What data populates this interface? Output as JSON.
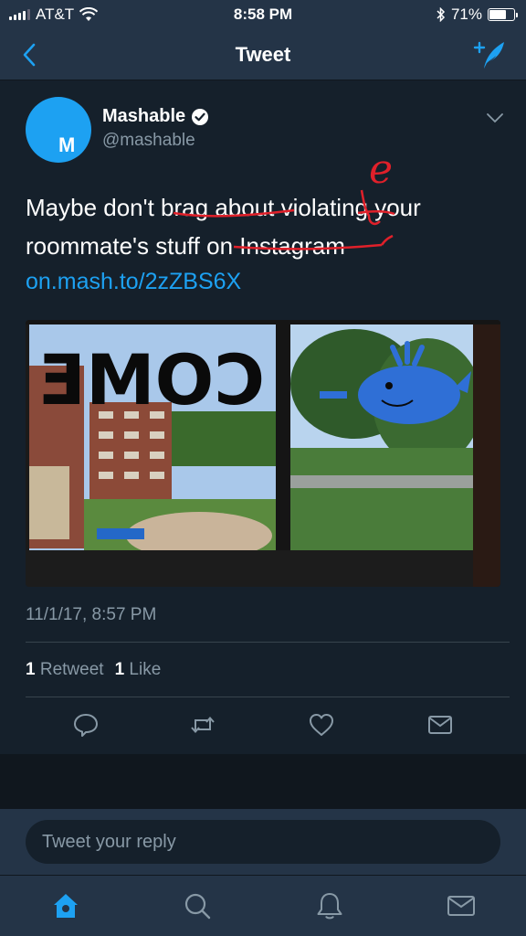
{
  "status_bar": {
    "carrier": "AT&T",
    "time": "8:58 PM",
    "battery": "71%",
    "battery_level": 0.71,
    "icons": [
      "signal-icon",
      "wifi-icon",
      "bluetooth-icon",
      "battery-icon"
    ]
  },
  "nav": {
    "title": "Tweet",
    "back_icon": "chevron-left-icon",
    "compose_icon": "compose-tweet-icon"
  },
  "tweet": {
    "author_name": "Mashable",
    "author_handle": "@mashable",
    "avatar_letter": "M",
    "text_line1": "Maybe don't brag about violating your",
    "text_line2": "roommate's stuff on Instagram",
    "handwritten_annotation": "e",
    "link": "on.mash.to/2zZBS6X",
    "photo_sign_text": "COME",
    "timestamp": "11/1/17, 8:57 PM",
    "retweet_count": "1",
    "retweet_label": "Retweet",
    "like_count": "1",
    "like_label": "Like",
    "actions": [
      "reply-icon",
      "retweet-icon",
      "like-icon",
      "share-icon"
    ]
  },
  "reply": {
    "placeholder": "Tweet your reply"
  },
  "tabbar": {
    "items": [
      "home-icon",
      "search-icon",
      "notifications-icon",
      "messages-icon"
    ],
    "active": "home-icon"
  },
  "colors": {
    "background": "#15202b",
    "bar": "#243447",
    "accent": "#1da1f2",
    "muted": "#8899a6",
    "annotation": "#e0202a"
  }
}
